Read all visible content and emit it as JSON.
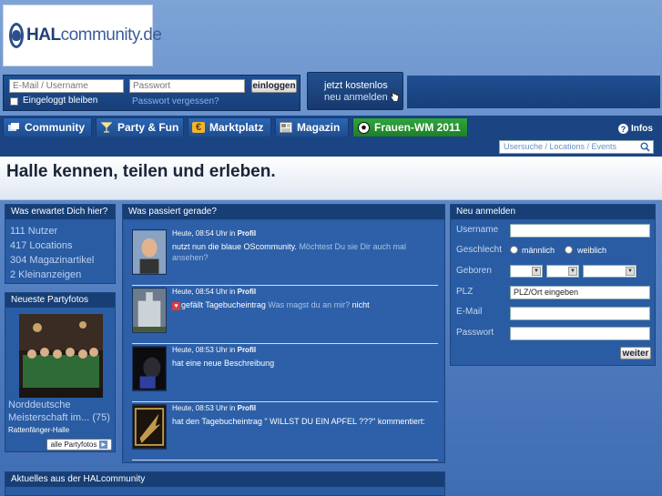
{
  "logo": {
    "text_main": "HAL",
    "text_rest": "community.de"
  },
  "login": {
    "email_placeholder": "E-Mail / Username",
    "password_placeholder": "Passwort",
    "login_button": "einloggen",
    "remember_label": "Eingeloggt bleiben",
    "forgot_link": "Passwort vergessen?"
  },
  "register_cta": {
    "line1": "jetzt kostenlos",
    "line2": "neu anmelden"
  },
  "nav": {
    "tabs": [
      {
        "label": "Community",
        "icon": "community-icon"
      },
      {
        "label": "Party & Fun",
        "icon": "cocktail-icon"
      },
      {
        "label": "Marktplatz",
        "icon": "euro-icon"
      },
      {
        "label": "Magazin",
        "icon": "newspaper-icon"
      },
      {
        "label": "Frauen-WM 2011",
        "icon": "football-icon"
      }
    ],
    "infos_label": "Infos",
    "search_placeholder": "Usersuche / Locations / Events"
  },
  "headline": "Halle kennen, teilen und erleben.",
  "left": {
    "expect_title": "Was erwartet Dich hier?",
    "stats": [
      "111 Nutzer",
      "417 Locations",
      "304 Magazinartikel",
      "2 Kleinanzeigen"
    ],
    "party_title": "Neueste Partyfotos",
    "party_caption_1": "Norddeutsche",
    "party_caption_2": "Meisterschaft im...",
    "party_count": "(75)",
    "party_location": "Rattenfänger-Halle",
    "party_button": "alle Partyfotos"
  },
  "feed": {
    "title": "Was passiert gerade?",
    "items": [
      {
        "time": "Heute, 08:54 Uhr in",
        "section": "Profil",
        "action": "nutzt nun die blaue OScommunity.",
        "muted": "Möchtest Du sie Dir auch mal ansehen?",
        "tail": ""
      },
      {
        "time": "Heute, 08:54 Uhr in",
        "section": "Profil",
        "action": "gefällt Tagebucheintrag",
        "muted": "Was magst du an mir?",
        "tail": "nicht"
      },
      {
        "time": "Heute, 08:53 Uhr in",
        "section": "Profil",
        "action": "hat eine neue Beschreibung",
        "muted": "",
        "tail": ""
      },
      {
        "time": "Heute, 08:53 Uhr in",
        "section": "Profil",
        "action": "hat den Tagebucheintrag \" WILLST DU EIN APFEL ???\" kommentiert:",
        "muted": "",
        "tail": ""
      }
    ]
  },
  "news_title": "Aktuelles aus der HALcommunity",
  "signup": {
    "title": "Neu anmelden",
    "username_label": "Username",
    "gender_label": "Geschlecht",
    "male_label": "männlich",
    "female_label": "weiblich",
    "born_label": "Geboren",
    "plz_label": "PLZ",
    "plz_value": "PLZ/Ort eingeben",
    "email_label": "E-Mail",
    "password_label": "Passwort",
    "submit": "weiter"
  },
  "colors": {
    "accent_blue": "#1b4582",
    "wm_green": "#2fa63c",
    "headline_text": "#1a2438"
  }
}
